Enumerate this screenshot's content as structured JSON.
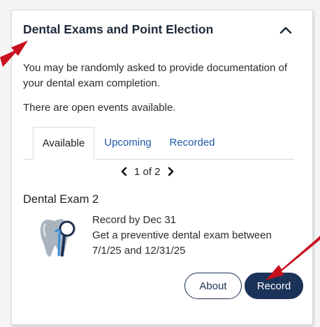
{
  "card": {
    "title": "Dental Exams and Point Election",
    "intro": "You may be randomly asked to provide documentation of your dental exam completion.",
    "events_note": "There are open events available."
  },
  "tabs": [
    {
      "label": "Available",
      "active": true
    },
    {
      "label": "Upcoming",
      "active": false
    },
    {
      "label": "Recorded",
      "active": false
    }
  ],
  "pager": {
    "text": "1 of 2"
  },
  "exam": {
    "title": "Dental Exam 2",
    "record_by": "Record by Dec 31",
    "description": "Get a preventive dental exam between 7/1/25 and 12/31/25",
    "icon": "tooth-mirror-icon"
  },
  "buttons": {
    "about": "About",
    "record": "Record"
  },
  "colors": {
    "title": "#1e2a3a",
    "link": "#1f5aa8",
    "primary": "#1b3358",
    "annotation_arrow": "#c8101e"
  }
}
